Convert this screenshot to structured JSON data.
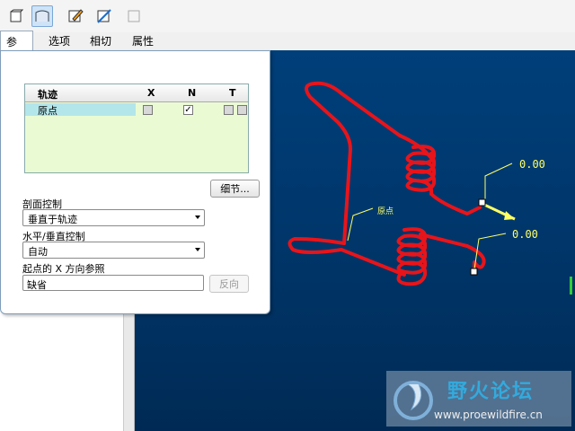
{
  "toolbar": {
    "buttons": [
      {
        "icon": "solid-icon"
      },
      {
        "icon": "surface-icon"
      },
      {
        "icon": "sketch-edit-icon"
      },
      {
        "icon": "taper-icon"
      },
      {
        "icon": "thin-icon"
      }
    ]
  },
  "tabs": [
    "参照",
    "选项",
    "相切",
    "属性"
  ],
  "panel": {
    "table": {
      "headers": [
        "轨迹",
        "X",
        "N",
        "T"
      ],
      "row": {
        "name": "原点",
        "x_checked": false,
        "n_checked": true
      }
    },
    "details_button": "细节...",
    "section_control_label": "剖面控制",
    "section_control_value": "垂直于轨迹",
    "horiz_vert_label": "水平/垂直控制",
    "horiz_vert_value": "自动",
    "x_ref_label": "起点的 X 方向参照",
    "x_ref_value": "缺省",
    "flip_button": "反向"
  },
  "viewport": {
    "dim1": "0.00",
    "dim2": "0.00",
    "origin_label": "原点",
    "curve_color": "#e8141a",
    "background": "#003f7a"
  },
  "watermark": {
    "title": "野火论坛",
    "url": "www.proewildfire.cn"
  }
}
